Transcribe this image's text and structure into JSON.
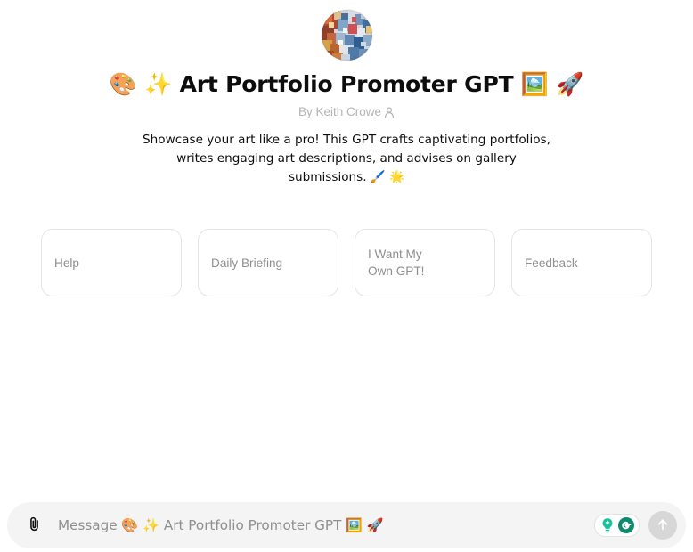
{
  "gpt": {
    "avatar_alt": "gpt-avatar-abstract-art",
    "title": "🎨 ✨ Art Portfolio Promoter GPT 🖼️ 🚀",
    "byline": "By Keith Crowe",
    "description": "Showcase your art like a pro! This GPT crafts captivating portfolios, writes engaging art descriptions, and advises on gallery submissions. 🖌️ 🌟"
  },
  "starters": [
    {
      "label": "Help"
    },
    {
      "label": "Daily Briefing"
    },
    {
      "label": "I Want My\nOwn GPT!"
    },
    {
      "label": "Feedback"
    }
  ],
  "composer": {
    "placeholder": "Message 🎨 ✨ Art Portfolio Promoter GPT 🖼️ 🚀",
    "value": "",
    "attach_label": "Attach files",
    "send_label": "Send message",
    "grammarly_label": "Grammarly"
  },
  "colors": {
    "page_background": "#ffffff",
    "composer_background": "#f4f4f4",
    "card_border": "#e5e5e5",
    "muted_text": "#8f8f8f",
    "byline_text": "#b4b4b4",
    "grammarly_green": "#15C39A",
    "grammarly_dark": "#0E8A6E",
    "send_button": "#d7d7d7"
  }
}
